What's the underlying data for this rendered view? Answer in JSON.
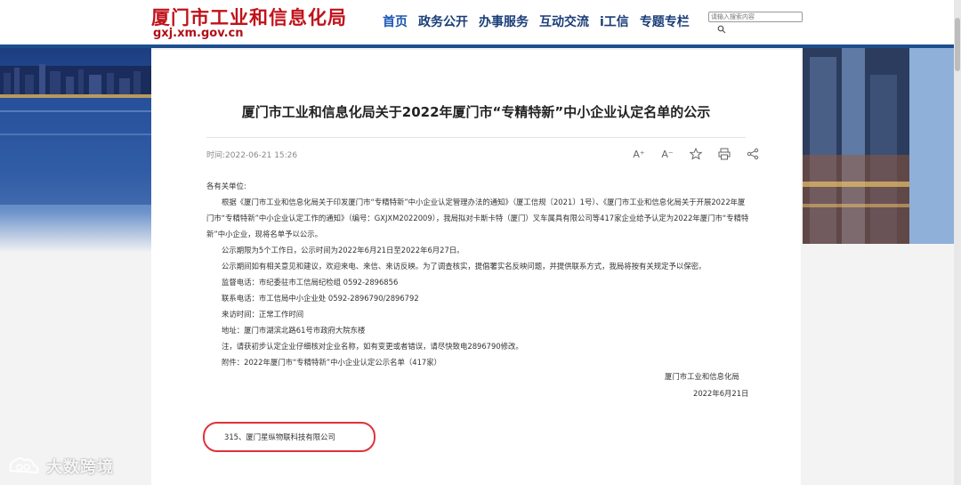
{
  "header": {
    "site_title": "厦门市工业和信息化局",
    "site_url": "gxj.xm.gov.cn",
    "nav": [
      {
        "label": "首页"
      },
      {
        "label": "政务公开"
      },
      {
        "label": "办事服务"
      },
      {
        "label": "互动交流"
      },
      {
        "label": "i工信"
      },
      {
        "label": "专题专栏"
      }
    ],
    "search": {
      "placeholder": "请输入搜索内容"
    }
  },
  "article": {
    "title": "厦门市工业和信息化局关于2022年厦门市“专精特新”中小企业认定名单的公示",
    "published": "时间:2022-06-21 15:26",
    "tools": {
      "font_larger": "A⁺",
      "font_smaller": "A⁻"
    },
    "salutation": "各有关单位:",
    "paragraphs": [
      "根据《厦门市工业和信息化局关于印发厦门市“专精特新”中小企业认定管理办法的通知》（厦工信规〔2021〕1号）、《厦门市工业和信息化局关于开展2022年厦门市“专精特新”中小企业认定工作的通知》（编号：GXJXM2022009），我局拟对卡斯卡特（厦门）叉车属具有限公司等417家企业给予认定为2022年厦门市“专精特新”中小企业，现将名单予以公示。",
      "公示期限为5个工作日，公示时间为2022年6月21日至2022年6月27日。",
      "公示期间如有相关意见和建议，欢迎来电、来信、来访反映。为了调查核实，提倡署实名反映问题，并提供联系方式，我局将按有关规定予以保密。",
      "监督电话：市纪委驻市工信局纪检组 0592-2896856",
      "联系电话：市工信局中小企业处 0592-2896790/2896792",
      "来访时间：正常工作时间",
      "地址：厦门市湖滨北路61号市政府大院东楼",
      "注，请获初步认定企业仔细核对企业名称，如有变更或者错误，请尽快致电2896790修改。",
      "附件：2022年厦门市“专精特新”中小企业认定公示名单（417家）"
    ],
    "signature_org": "厦门市工业和信息化局",
    "signature_date": "2022年6月21日",
    "highlighted_entry": "315、厦门星纵物联科技有限公司"
  },
  "watermark": {
    "text": "大数跨境"
  },
  "colors": {
    "brand_red": "#c0121a",
    "nav_blue": "#1a3d78",
    "header_rule": "#1d4f8f",
    "highlight": "#e0313b"
  }
}
